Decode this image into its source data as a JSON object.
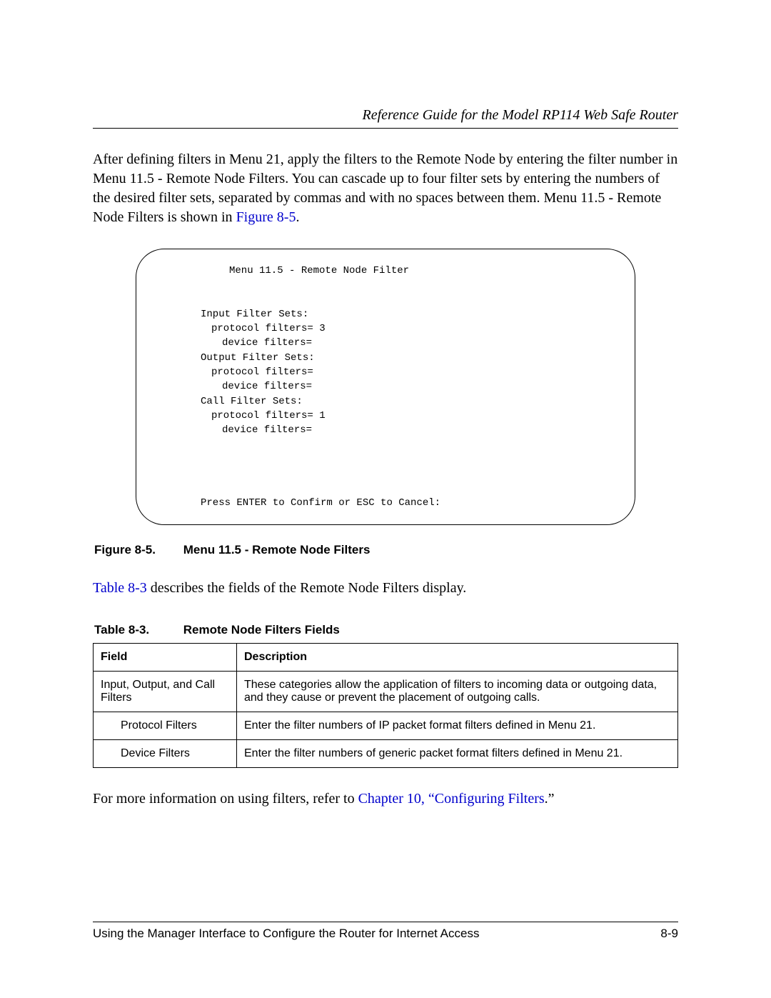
{
  "header": {
    "title": "Reference Guide for the Model RP114 Web Safe Router"
  },
  "para1": {
    "text_before_link": "After defining filters in Menu 21, apply the filters to the Remote Node by entering the filter number in Menu 11.5 - Remote Node Filters. You can cascade up to four filter sets by entering the numbers of the desired filter sets, separated by commas and with no spaces between them. Menu 11.5 - Remote Node Filters is shown in ",
    "link": "Figure 8-5",
    "after": "."
  },
  "menu_display": {
    "title": "Menu 11.5 - Remote Node Filter",
    "input_header": "Input Filter Sets:",
    "input_protocol": "protocol filters= 3",
    "input_device": "device filters=",
    "output_header": "Output Filter Sets:",
    "output_protocol": "protocol filters=",
    "output_device": "device filters=",
    "call_header": "Call Filter Sets:",
    "call_protocol": "protocol filters= 1",
    "call_device": "device filters=",
    "footer": "Press ENTER to Confirm or ESC to Cancel:"
  },
  "figure_caption": {
    "label": "Figure 8-5.",
    "text": "Menu 11.5 - Remote Node Filters"
  },
  "para2": {
    "link": "Table 8-3",
    "after": " describes the fields of the Remote Node Filters display."
  },
  "table_caption": {
    "label": "Table 8-3.",
    "text": "Remote Node Filters Fields"
  },
  "table": {
    "headers": {
      "field": "Field",
      "description": "Description"
    },
    "rows": [
      {
        "field": "Input, Output, and Call Filters",
        "indent": false,
        "description": "These categories allow the application of filters to incoming data or outgoing data, and they cause or prevent the placement of outgoing calls."
      },
      {
        "field": "Protocol Filters",
        "indent": true,
        "description": "Enter the filter numbers of IP packet format filters defined in Menu 21."
      },
      {
        "field": "Device Filters",
        "indent": true,
        "description": "Enter the filter numbers of generic packet format filters defined in Menu 21."
      }
    ]
  },
  "para3": {
    "before": "For more information on using filters, refer to ",
    "link": "Chapter 10, “Configuring Filters",
    "after": ".”"
  },
  "footer": {
    "left": "Using the Manager Interface to Configure the Router for Internet Access",
    "right": "8-9"
  }
}
